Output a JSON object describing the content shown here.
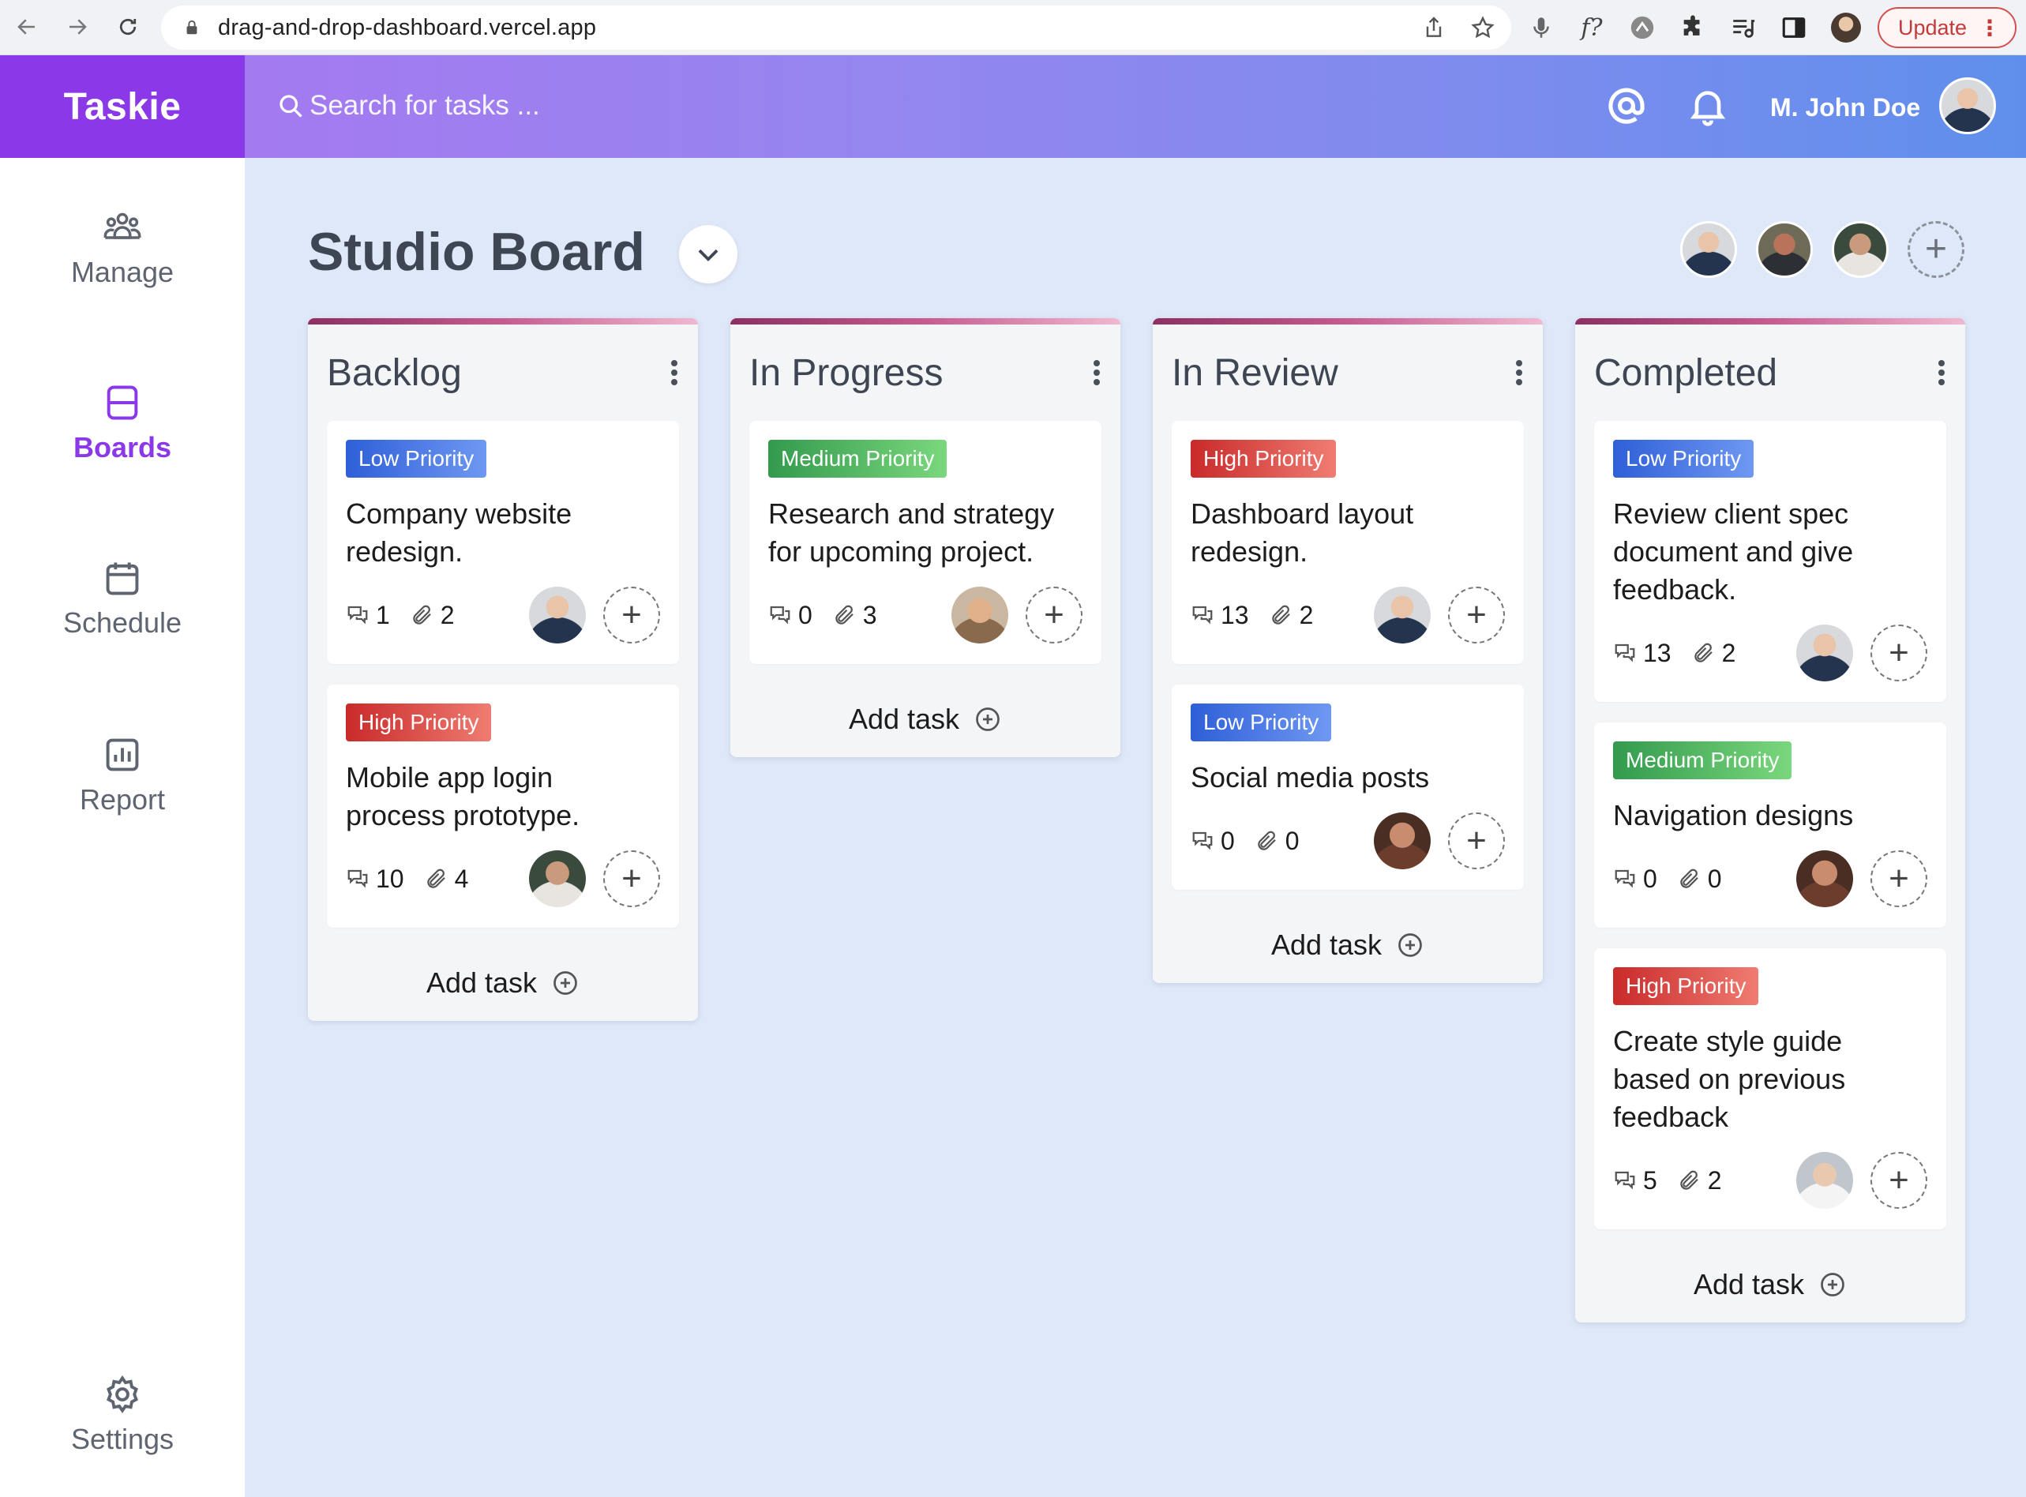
{
  "browser": {
    "url": "drag-and-drop-dashboard.vercel.app",
    "update_label": "Update",
    "function_icon_text": "f?"
  },
  "app": {
    "name": "Taskie",
    "search_placeholder": "Search for tasks ...",
    "user_name": "M. John Doe"
  },
  "sidebar": {
    "items": [
      {
        "label": "Manage",
        "icon": "users-icon",
        "active": false
      },
      {
        "label": "Boards",
        "icon": "boards-icon",
        "active": true
      },
      {
        "label": "Schedule",
        "icon": "calendar-icon",
        "active": false
      },
      {
        "label": "Report",
        "icon": "chart-icon",
        "active": false
      },
      {
        "label": "Settings",
        "icon": "gear-icon",
        "active": false
      }
    ]
  },
  "board": {
    "title": "Studio Board",
    "add_task_label": "Add task",
    "columns": [
      {
        "title": "Backlog",
        "cards": [
          {
            "priority": "Low Priority",
            "title": "Company website redesign.",
            "comments": "1",
            "attachments": "2"
          },
          {
            "priority": "High Priority",
            "title": "Mobile app login process prototype.",
            "comments": "10",
            "attachments": "4"
          }
        ]
      },
      {
        "title": "In Progress",
        "cards": [
          {
            "priority": "Medium Priority",
            "title": "Research and strategy for upcoming project.",
            "comments": "0",
            "attachments": "3"
          }
        ]
      },
      {
        "title": "In Review",
        "cards": [
          {
            "priority": "High Priority",
            "title": "Dashboard layout redesign.",
            "comments": "13",
            "attachments": "2"
          },
          {
            "priority": "Low Priority",
            "title": "Social media posts",
            "comments": "0",
            "attachments": "0"
          }
        ]
      },
      {
        "title": "Completed",
        "cards": [
          {
            "priority": "Low Priority",
            "title": "Review client spec document and give feedback.",
            "comments": "13",
            "attachments": "2"
          },
          {
            "priority": "Medium Priority",
            "title": "Navigation designs",
            "comments": "0",
            "attachments": "0"
          },
          {
            "priority": "High Priority",
            "title": "Create style guide based on previous feedback",
            "comments": "5",
            "attachments": "2"
          }
        ]
      }
    ]
  },
  "colors": {
    "brand": "#8a38e8",
    "low": "#2f5fd8",
    "medium": "#339a4d",
    "high": "#c92a2a"
  }
}
